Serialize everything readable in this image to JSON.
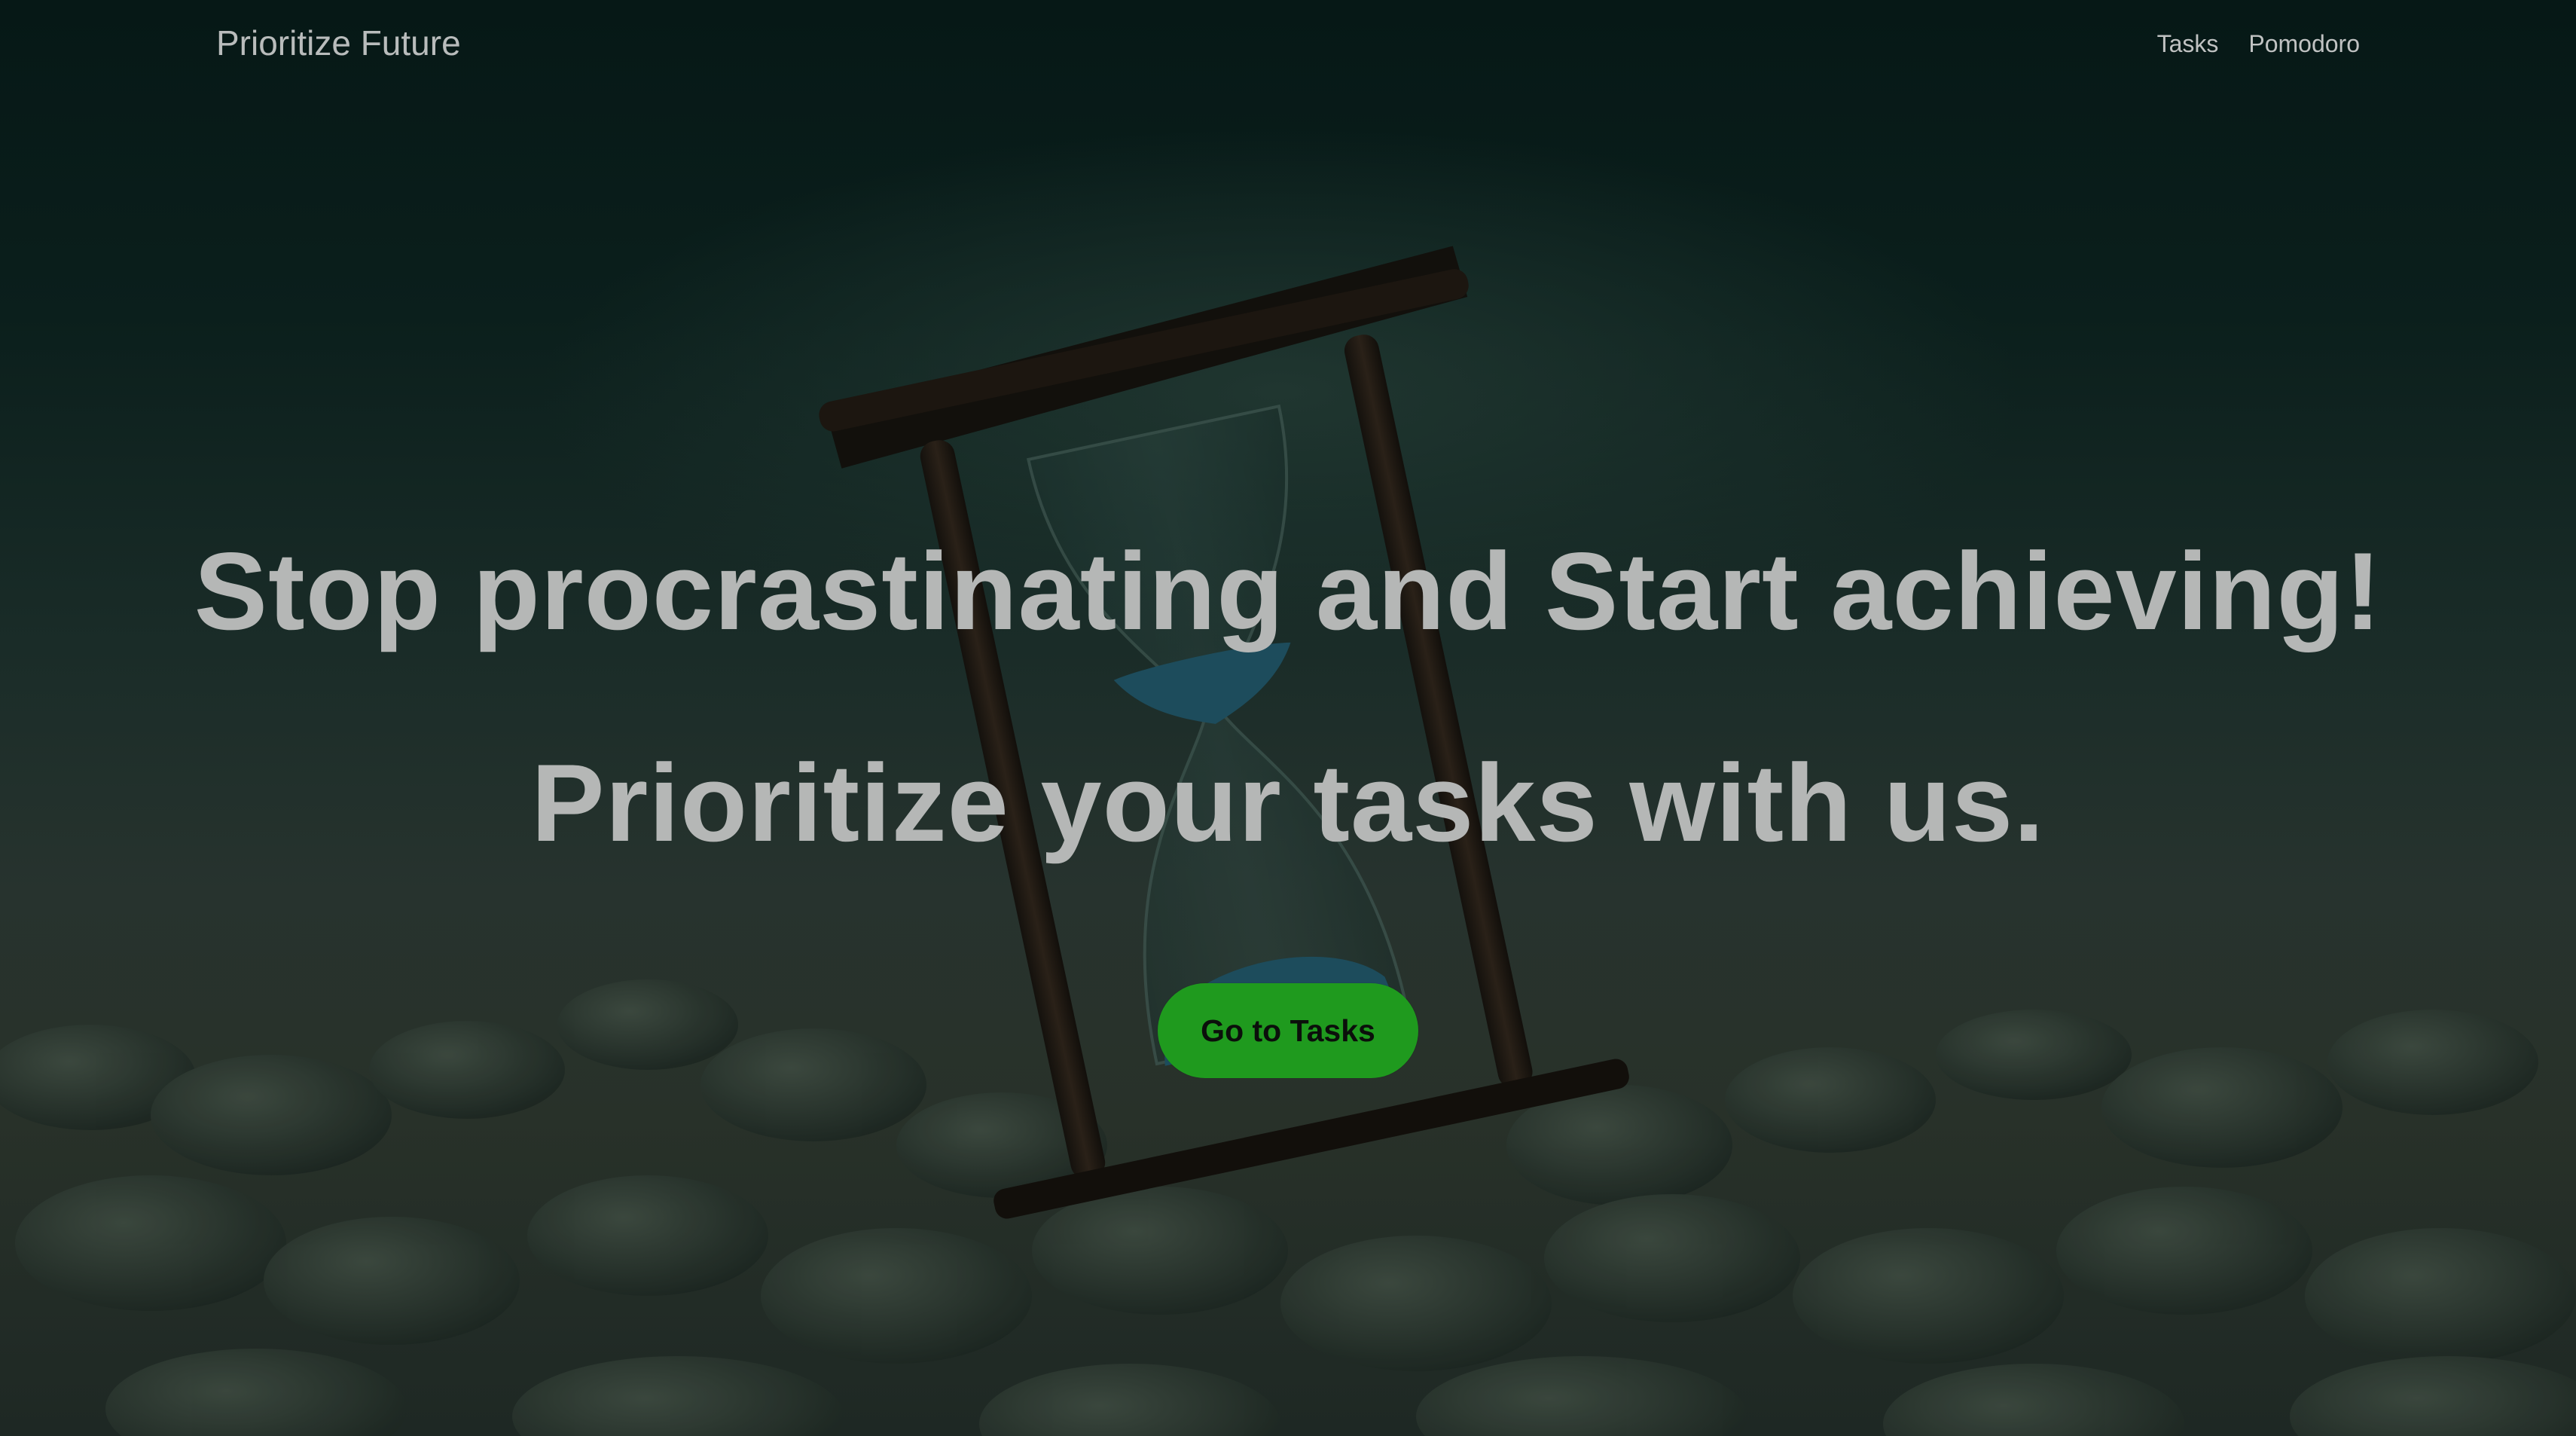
{
  "nav": {
    "brand": "Prioritize Future",
    "links": [
      {
        "label": "Tasks"
      },
      {
        "label": "Pomodoro"
      }
    ]
  },
  "hero": {
    "headline_1": "Stop procrastinating and Start achieving!",
    "headline_2": "Prioritize your tasks with us.",
    "cta_label": "Go to Tasks"
  },
  "colors": {
    "accent": "#1f9a1e",
    "text": "#b5b7b6",
    "background": "#0c1a17"
  },
  "background_image": "hourglass-on-pebbles"
}
